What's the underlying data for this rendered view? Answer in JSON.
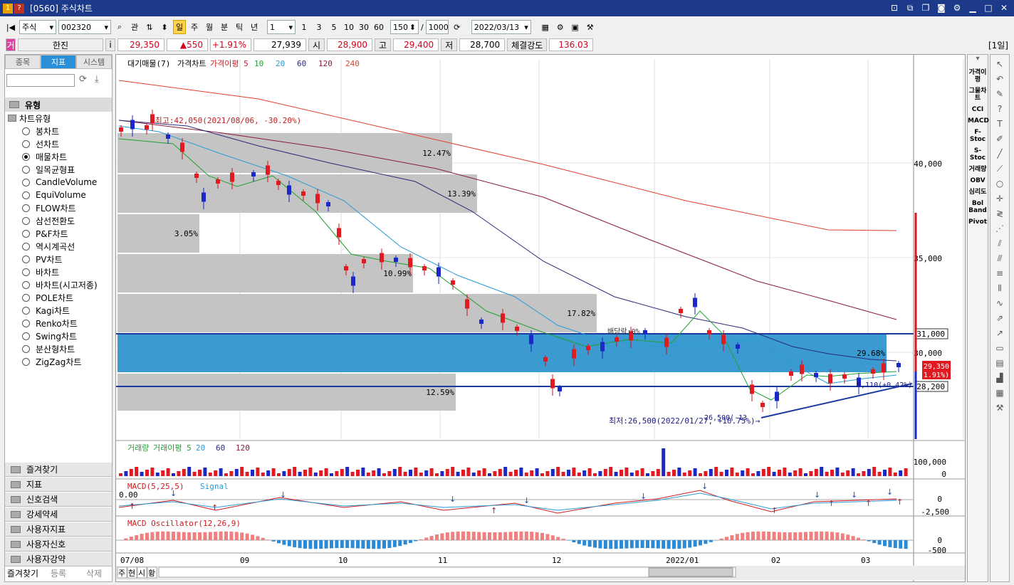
{
  "window": {
    "badge1": "1",
    "badge2": "?",
    "title": "[0560] 주식차트"
  },
  "toolbar": {
    "market": "주식",
    "code": "002320",
    "kwan": "관",
    "periods": [
      "일",
      "주",
      "월",
      "분",
      "틱",
      "년"
    ],
    "period_num": "1",
    "quick": [
      "1",
      "3",
      "5",
      "10",
      "30",
      "60"
    ],
    "count": "150",
    "slash": "/",
    "total": "1000",
    "date": "2022/03/13"
  },
  "quote": {
    "name": "한진",
    "kind": "거",
    "i": "i",
    "price": "29,350",
    "change": "▲550",
    "rate": "+1.91%",
    "volume": "27,939",
    "open_label": "시",
    "open": "28,900",
    "high_label": "고",
    "high": "29,400",
    "low_label": "저",
    "low": "28,700",
    "strength_label": "체결강도",
    "strength": "136.03",
    "period_tag": "[1일]"
  },
  "left": {
    "tabs": [
      "종목",
      "지표",
      "시스템"
    ],
    "section": "유형",
    "chart_type": "차트유형",
    "options": [
      "봉차트",
      "선차트",
      "매물차트",
      "일목균형표",
      "CandleVolume",
      "EquiVolume",
      "FLOW차트",
      "삼선전환도",
      "P&F차트",
      "역시계곡선",
      "PV차트",
      "바차트",
      "바차트(시고저종)",
      "POLE차트",
      "Kagi차트",
      "Renko차트",
      "Swing차트",
      "분산형차트",
      "ZigZag차트"
    ],
    "selected": "매물차트",
    "bottom_sections": [
      "즐겨찾기",
      "지표",
      "신호검색",
      "강세약세",
      "사용자지표",
      "사용자신호",
      "사용자강약"
    ],
    "buttons": [
      "즐겨찾기",
      "등록",
      "삭제"
    ]
  },
  "chart": {
    "legend_main": [
      "대기매물(7)",
      "가격차트",
      "가격이평 5",
      "10",
      "20",
      "60",
      "120",
      "240"
    ],
    "legend_volume": [
      "거래량",
      "거래이평 5",
      "20",
      "60",
      "120"
    ],
    "legend_macd": [
      "MACD(5,25,5)",
      "Signal"
    ],
    "legend_osc": [
      "MACD Oscillator(12,26,9)"
    ],
    "high_note": "←최고:42,050(2021/08/06, -30.20%)",
    "low_note": "최저:26,500(2022/01/27, +10.75%)→",
    "low_short": "26,500(-13",
    "div_note": "배당락:0%",
    "trend_note": "8,110(+0.42%)",
    "vp_pcts": [
      "12.47%",
      "13.39%",
      "3.05%",
      "10.99%",
      "17.82%",
      "29.68%",
      "12.59%"
    ],
    "price_ticks": [
      "40,000",
      "35,000",
      "30,000"
    ],
    "level_31000": "31,000",
    "level_28200": "28,200",
    "cur_price": "29,350",
    "cur_rate": "(1.91%)",
    "vol_ticks": [
      "100,000",
      "0"
    ],
    "macd_ticks": [
      "0",
      "-2,500"
    ],
    "macd_zero": "0.00",
    "osc_ticks": [
      "0",
      "-500"
    ],
    "x_ticks": [
      "07/08",
      "09",
      "10",
      "11",
      "12",
      "2022/01",
      "02",
      "03"
    ],
    "bottom_tabs": [
      "주",
      "현",
      "시",
      "황"
    ]
  },
  "right_tools": {
    "labels": [
      "가격이평",
      "그물차트",
      "CCI",
      "MACD",
      "F-Stoc",
      "S-Stoc",
      "거래량",
      "OBV",
      "심리도",
      "Bol Band",
      "Pivot"
    ]
  }
}
